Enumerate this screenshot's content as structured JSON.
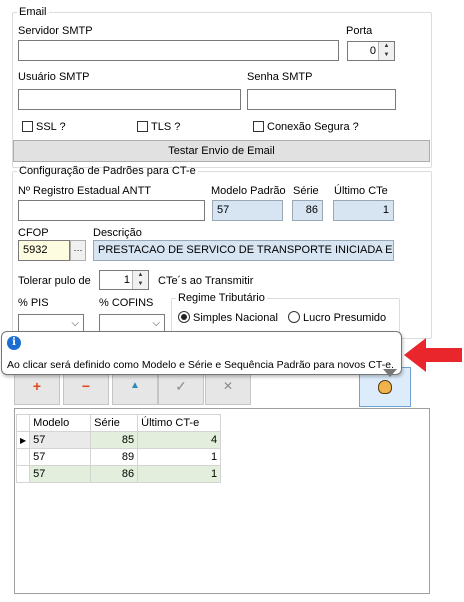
{
  "email": {
    "group_title": "Email",
    "smtp_server_label": "Servidor SMTP",
    "smtp_server_value": "",
    "port_label": "Porta",
    "port_value": "0",
    "smtp_user_label": "Usuário SMTP",
    "smtp_user_value": "",
    "smtp_password_label": "Senha SMTP",
    "smtp_password_value": "",
    "ssl_label": "SSL ?",
    "ssl_checked": false,
    "tls_label": "TLS ?",
    "tls_checked": false,
    "secure_conn_label": "Conexão Segura ?",
    "secure_conn_checked": false,
    "test_button_label": "Testar Envio de Email"
  },
  "cte_config": {
    "group_title": "Configuração de Padrões para CT-e",
    "antt_label": "Nº Registro Estadual ANTT",
    "antt_value": "",
    "model_label": "Modelo Padrão",
    "model_value": "57",
    "serie_label": "Série",
    "serie_value": "86",
    "last_cte_label": "Último CTe",
    "last_cte_value": "1",
    "cfop_label": "CFOP",
    "cfop_value": "5932",
    "cfop_lookup_label": "···",
    "description_label": "Descrição",
    "description_value": "PRESTACAO DE SERVICO DE TRANSPORTE INICIADA EM UNI",
    "tolerate_label": "Tolerar pulo de",
    "tolerate_value": "1",
    "tolerate_suffix": "CTe´s ao Transmitir",
    "pis_label": "% PIS",
    "cofins_label": "% COFINS",
    "regime_label": "Regime Tributário",
    "regime_simples": "Simples Nacional",
    "regime_lucro": "Lucro Presumido",
    "regime_selected": "Simples Nacional"
  },
  "tooltip": {
    "text": "Ao clicar será definido como Modelo e Série e Sequência Padrão para novos CT-e."
  },
  "navigator": {
    "add_symbol": "+",
    "remove_symbol": "−",
    "edit_symbol": "▲",
    "post_symbol": "✓",
    "cancel_symbol": "✕"
  },
  "grid": {
    "columns": [
      "Modelo",
      "Série",
      "Último CT-e"
    ],
    "rows": [
      {
        "modelo": "57",
        "serie": "85",
        "ultimo": "4"
      },
      {
        "modelo": "57",
        "serie": "89",
        "ultimo": "1"
      },
      {
        "modelo": "57",
        "serie": "86",
        "ultimo": "1"
      }
    ]
  },
  "colors": {
    "readonly_field": "#d7e4f2",
    "row_highlight": "#e3efdc",
    "arrow": "#e8262b",
    "info_icon": "#1c6fd1"
  }
}
